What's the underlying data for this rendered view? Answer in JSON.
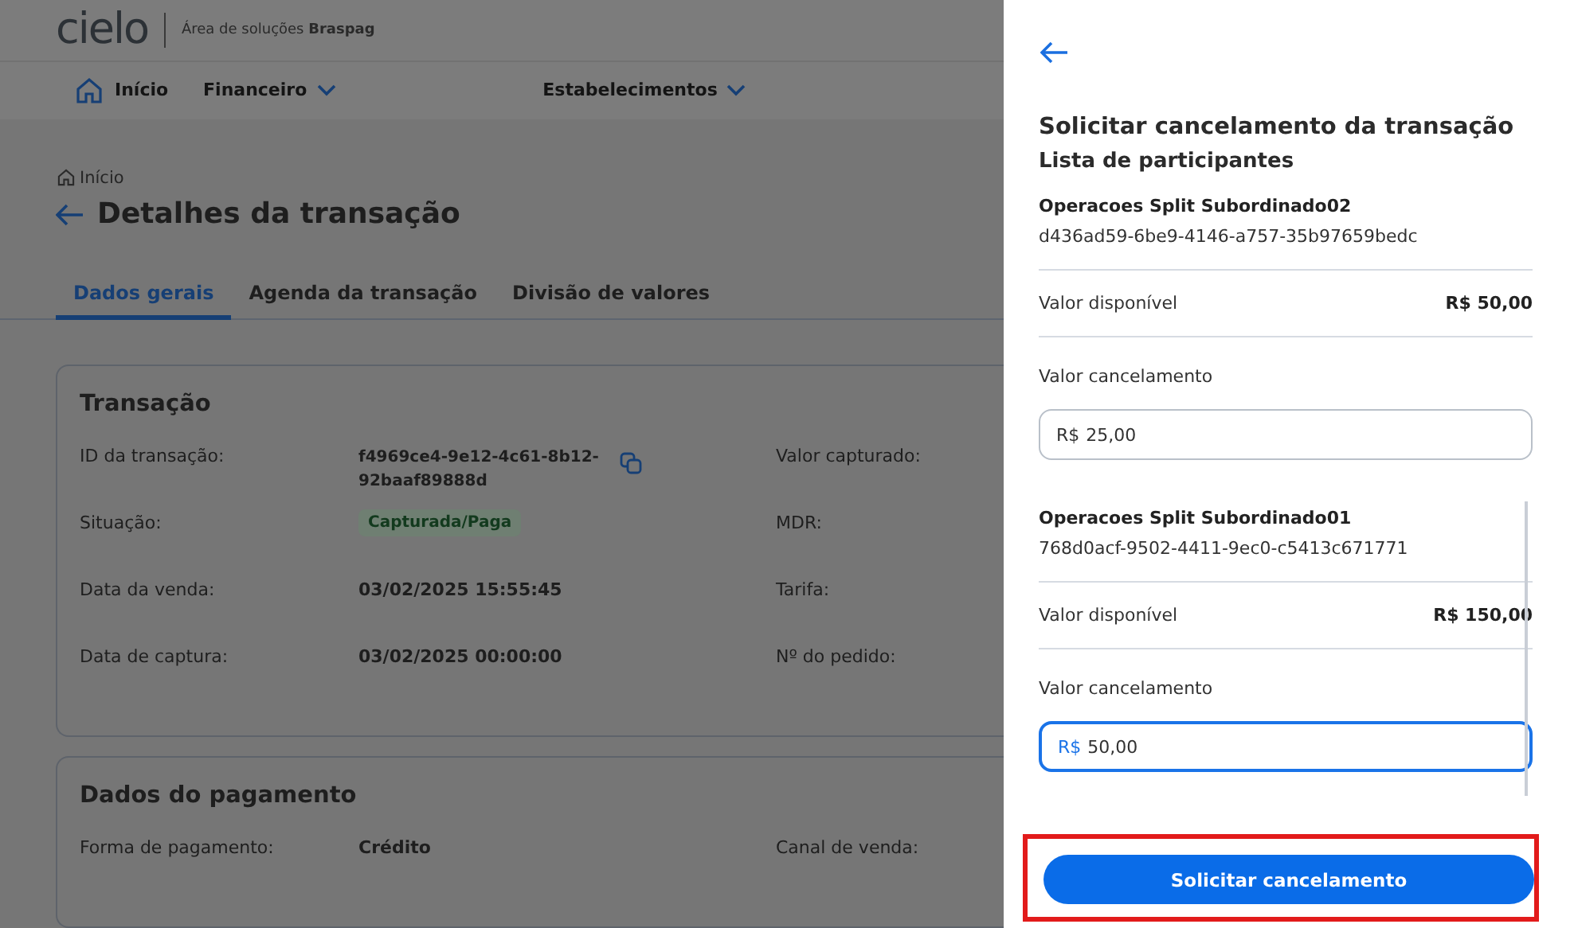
{
  "header": {
    "logo": "cielo",
    "subtitle": "Área de soluções **Braspag**"
  },
  "nav": [
    {
      "label": "Início",
      "kind": "home"
    },
    {
      "label": "Financeiro",
      "kind": "menu"
    },
    {
      "label": "Estabelecimentos",
      "kind": "menu"
    }
  ],
  "breadcrumb": "Início",
  "page_title": "Detalhes da transação",
  "tabs": [
    {
      "label": "Dados gerais",
      "selected": true
    },
    {
      "label": "Agenda da transação",
      "selected": false
    },
    {
      "label": "Divisão de valores",
      "selected": false
    }
  ],
  "cards": [
    {
      "title": "Transação",
      "rows": [
        {
          "label": "ID da transação:",
          "value": "f4969ce4-9e12-4c61-8b12-92baaf89888d",
          "kind": "copy",
          "label2": "Valor capturado:"
        },
        {
          "label": "Situação:",
          "value": "Capturada/Paga",
          "kind": "badge",
          "label2": "MDR:"
        },
        {
          "label": "Data da venda:",
          "value": "03/02/2025 15:55:45",
          "kind": "text",
          "label2": "Tarifa:"
        },
        {
          "label": "Data de captura:",
          "value": "03/02/2025 00:00:00",
          "kind": "text",
          "label2": "Nº do pedido:"
        }
      ]
    },
    {
      "title": "Dados do pagamento",
      "rows": [
        {
          "label": "Forma de pagamento:",
          "value": "Crédito",
          "kind": "text",
          "label2": "Canal de venda:"
        }
      ]
    }
  ],
  "drawer": {
    "title": "Solicitar cancelamento da transação",
    "section": "Lista de participantes",
    "participants": [
      {
        "name": "Operacoes Split Subordinado02",
        "id": "d436ad59-6be9-4146-a757-35b97659bedc",
        "available_label": "Valor disponível",
        "available": "R$ 50,00",
        "cancel_label": "Valor cancelamento",
        "prefix": "R$",
        "value": "25,00",
        "focused": false
      },
      {
        "name": "Operacoes Split Subordinado01",
        "id": "768d0acf-9502-4411-9ec0-c5413c671771",
        "available_label": "Valor disponível",
        "available": "R$ 150,00",
        "cancel_label": "Valor cancelamento",
        "prefix": "R$",
        "value": "50,00",
        "focused": true
      }
    ],
    "button": "Solicitar cancelamento",
    "highlighted": true
  }
}
